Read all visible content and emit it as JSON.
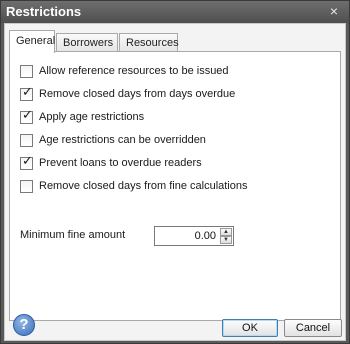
{
  "window": {
    "title": "Restrictions",
    "close_glyph": "×"
  },
  "tabs": [
    {
      "label": "General",
      "active": true
    },
    {
      "label": "Borrowers",
      "active": false
    },
    {
      "label": "Resources",
      "active": false
    }
  ],
  "options": [
    {
      "label": "Allow reference resources to be issued",
      "checked": false
    },
    {
      "label": "Remove closed days from days overdue",
      "checked": true
    },
    {
      "label": "Apply age restrictions",
      "checked": true
    },
    {
      "label": "Age restrictions can be overridden",
      "checked": false
    },
    {
      "label": "Prevent loans to overdue readers",
      "checked": true
    },
    {
      "label": "Remove closed days from fine calculations",
      "checked": false
    }
  ],
  "check_glyph": "✓",
  "minimum_fine": {
    "label": "Minimum fine amount",
    "value": "0.00"
  },
  "spinner": {
    "up_glyph": "▲",
    "down_glyph": "▼"
  },
  "footer": {
    "help_glyph": "?",
    "ok_label": "OK",
    "cancel_label": "Cancel"
  }
}
